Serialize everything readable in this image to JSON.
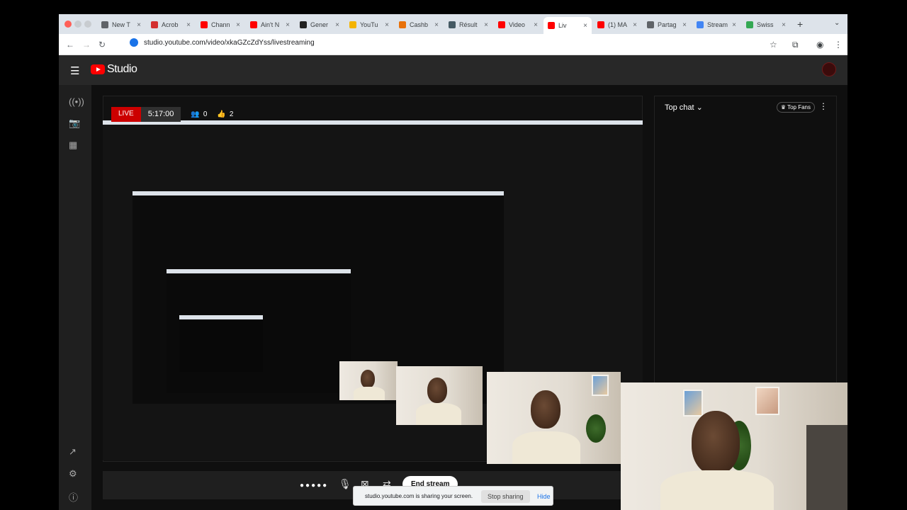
{
  "browser": {
    "tabs": [
      {
        "label": "New T",
        "color": "#5f6368"
      },
      {
        "label": "Acrob",
        "color": "#d32f2f"
      },
      {
        "label": "Chann",
        "color": "#ff0000"
      },
      {
        "label": "Ain't N",
        "color": "#ff0000"
      },
      {
        "label": "Gener",
        "color": "#222222"
      },
      {
        "label": "YouTu",
        "color": "#f4b400"
      },
      {
        "label": "Cashb",
        "color": "#e8710a"
      },
      {
        "label": "Résult",
        "color": "#455a64"
      },
      {
        "label": "Video",
        "color": "#ff0000"
      },
      {
        "label": "Liv",
        "color": "#ff0000",
        "active": true
      },
      {
        "label": "(1) MA",
        "color": "#ff0000"
      },
      {
        "label": "Partag",
        "color": "#5f6368"
      },
      {
        "label": "Stream",
        "color": "#4285f4"
      },
      {
        "label": "Swiss",
        "color": "#34a853"
      }
    ],
    "url": "studio.youtube.com/video/xkaGZcZdYss/livestreaming"
  },
  "studio": {
    "logo_text": "Studio"
  },
  "live": {
    "badge": "LIVE",
    "time": "5:17:00",
    "viewers": "0",
    "likes": "2"
  },
  "chat": {
    "top_chat": "Top chat",
    "top_fans": "Top Fans"
  },
  "controls": {
    "end_stream": "End stream"
  },
  "share": {
    "text": "studio.youtube.com is sharing your screen.",
    "stop_label": "Stop sharing",
    "hide_label": "Hide"
  }
}
